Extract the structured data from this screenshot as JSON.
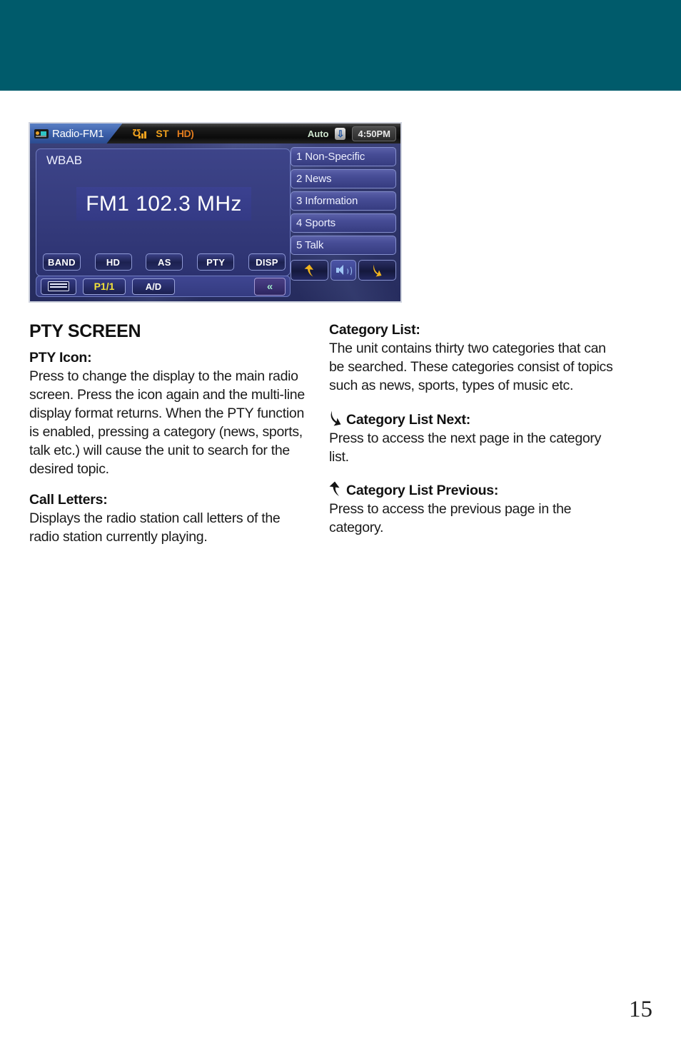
{
  "page": {
    "number": "15",
    "header_band_color": "#005b6b"
  },
  "radio_screenshot": {
    "status_bar": {
      "source_tab": {
        "icon": "radio-icon",
        "label": "Radio-FM1"
      },
      "signal_icon": "antenna-signal-icon",
      "stereo_label": "ST",
      "hd_label": "HD)",
      "auto_label": "Auto",
      "bluetooth_icon": "bluetooth-icon",
      "clock": "4:50PM"
    },
    "info_panel": {
      "call_letters": "WBAB",
      "frequency": "FM1  102.3 MHz",
      "function_buttons": [
        {
          "label": "BAND"
        },
        {
          "label": "HD"
        },
        {
          "label": "AS"
        },
        {
          "label": "PTY"
        },
        {
          "label": "DISP"
        }
      ]
    },
    "bottom_bar": {
      "keyboard_icon": "keyboard-icon",
      "preset_label": "P1/1",
      "ad_label": "A/D",
      "collapse_label": "«"
    },
    "category_list": [
      {
        "label": "1 Non-Specific"
      },
      {
        "label": "2 News"
      },
      {
        "label": "3 Information"
      },
      {
        "label": "4 Sports"
      },
      {
        "label": "5 Talk"
      }
    ],
    "nav_row": {
      "previous_icon": "curved-arrow-up-left-icon",
      "mute_icon": "speaker-icon",
      "next_icon": "curved-arrow-down-right-icon"
    }
  },
  "content": {
    "left_column": {
      "section_title": "PTY SCREEN",
      "entries": [
        {
          "term": "PTY Icon:",
          "body": "Press to change the display to the main radio screen.  Press the icon again and the multi-line display format returns. When the PTY function is enabled, pressing a category (news, sports, talk etc.) will cause the unit to search for the desired topic."
        },
        {
          "term": "Call Letters:",
          "body": "Displays the radio station call letters of the radio station currently playing."
        }
      ]
    },
    "right_column": {
      "entries": [
        {
          "term": "Category List:",
          "body": "The unit contains thirty two categories that can be searched. These categories consist of topics such as news, sports, types of music etc.",
          "icon": null
        },
        {
          "term": "Category List Next:",
          "body": "Press to access the next page in the category list.",
          "icon": "curved-arrow-down-right-icon"
        },
        {
          "term": "Category List Previous:",
          "body": "Press to access the previous page in the category.",
          "icon": "curved-arrow-up-left-icon"
        }
      ]
    }
  }
}
